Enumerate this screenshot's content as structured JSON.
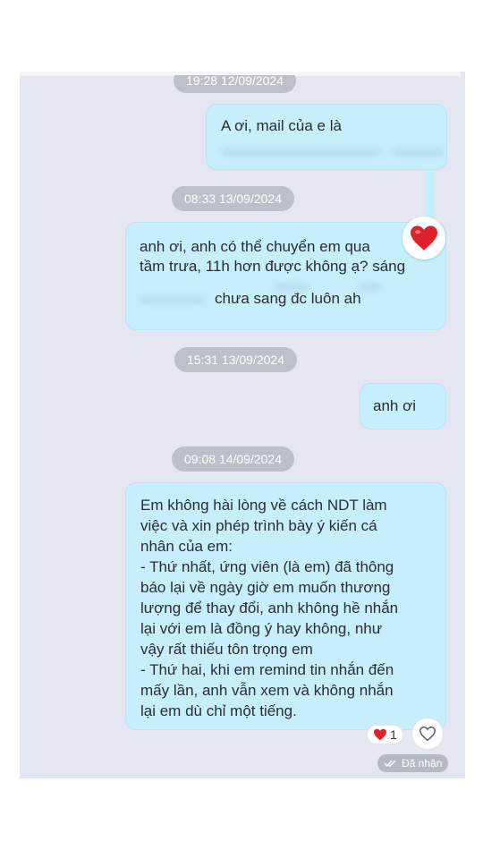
{
  "colors": {
    "bubble": "#c6eefb",
    "background": "#e4e7f1",
    "timestamp_bg": "#bcc0ca",
    "heart": "#e0202a"
  },
  "timestamps": [
    "19:28 12/09/2024",
    "08:33 13/09/2024",
    "15:31 13/09/2024",
    "09:08 14/09/2024"
  ],
  "messages": {
    "m1": {
      "line1": "A ơi, mail của e là"
    },
    "m2": {
      "line1": "anh ơi,  anh có thể chuyển em qua",
      "line2": "tầm trưa, 11h hơn được không ạ? sáng",
      "line3": "chưa sang đc luôn ah"
    },
    "m3": {
      "line1": "anh ơi"
    },
    "m4": {
      "lines": [
        "Em không hài lòng về cách NDT làm",
        "việc và xin phép trình bày ý kiến cá",
        "nhân của em:",
        "- Thứ nhất, ứng viên (là em) đã thông",
        "báo lại về ngày giờ em muốn thương",
        "lượng để thay đổi, anh không hề nhắn",
        "lại với em là đồng ý hay không, như",
        "vậy rất thiếu tôn trọng em",
        "- Thứ hai, khi em remind tin nhắn đến",
        "mấy lần, anh vẫn xem và không nhắn",
        "lại em dù chỉ một tiếng."
      ]
    }
  },
  "reaction": {
    "count": "1",
    "icon": "heart-icon"
  },
  "status": {
    "label": "Đã nhận",
    "icon": "double-check-icon"
  }
}
